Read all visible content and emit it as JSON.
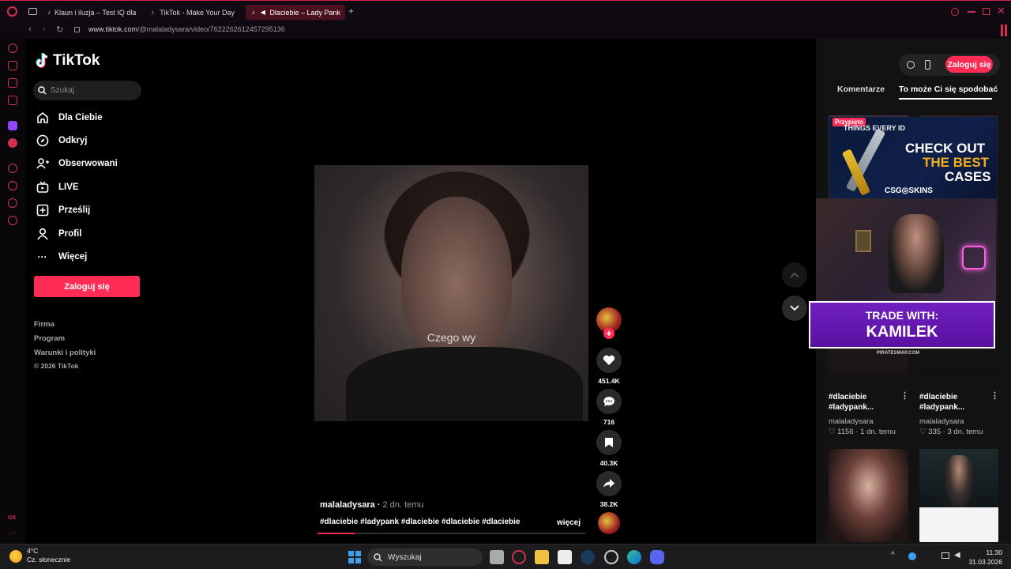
{
  "browser": {
    "tabs": [
      {
        "label": "Klaun i iluzja – Test IQ dla ..."
      },
      {
        "label": "TikTok - Make Your Day"
      },
      {
        "label": "Dlaciebie – Lady Pank"
      }
    ],
    "url_host": "www.tiktok.com",
    "url_path": "/@malaladysara/video/7622262612457295136"
  },
  "tiktok": {
    "logo_text": "TikTok",
    "search_placeholder": "Szukaj",
    "nav": [
      {
        "label": "Dla Ciebie",
        "icon": "home-icon"
      },
      {
        "label": "Odkryj",
        "icon": "compass-icon"
      },
      {
        "label": "Obserwowani",
        "icon": "following-icon"
      },
      {
        "label": "LIVE",
        "icon": "live-icon"
      },
      {
        "label": "Prześlij",
        "icon": "upload-icon"
      },
      {
        "label": "Profil",
        "icon": "profile-icon"
      },
      {
        "label": "Więcej",
        "icon": "more-icon"
      }
    ],
    "login_label": "Zaloguj się",
    "footer": [
      "Firma",
      "Program",
      "Warunki i polityki",
      "© 2026 TikTok"
    ],
    "accent": "#fe2c55"
  },
  "video": {
    "caption_overlay": "Czego wy",
    "author": "malaladysara",
    "time_ago": "2 dn. temu",
    "hashtags": "#dlaciebie #ladypank #dlaciebie #dlaciebie #dlaciebie",
    "more_label": "więcej",
    "progress_fraction": 0.14,
    "likes": "451.4K",
    "comments": "716",
    "saves": "40.3K",
    "shares": "38.2K"
  },
  "right_panel": {
    "login_label": "Zaloguj się",
    "tab_comments": "Komentarze",
    "tab_suggest": "To może Ci się spodobać",
    "pinned_badge": "Przypięto",
    "cards": [
      {
        "title": "#dlaciebie #ladypank...",
        "user": "malaladysara",
        "likes": "1156",
        "time": "1 dn. temu"
      },
      {
        "title": "#dlaciebie #ladypank...",
        "user": "malaladysara",
        "likes": "335",
        "time": "3 dn. temu"
      }
    ]
  },
  "ads": {
    "csgo_line1": "CHECK OUT",
    "csgo_line2": "THE BEST",
    "csgo_line3": "CASES",
    "csgo_brand": "CSG◎SKINS",
    "csgo_sub": "THINGS EVERY ID",
    "trade_line1": "TRADE WITH:",
    "trade_line2": "KAMILEK",
    "trade_site": "PIRATESWAP.COM"
  },
  "taskbar": {
    "temp": "4°C",
    "weather": "Cz. słonecznie",
    "search_label": "Wyszukaj",
    "time": "11:30",
    "date": "31.03.2026"
  }
}
